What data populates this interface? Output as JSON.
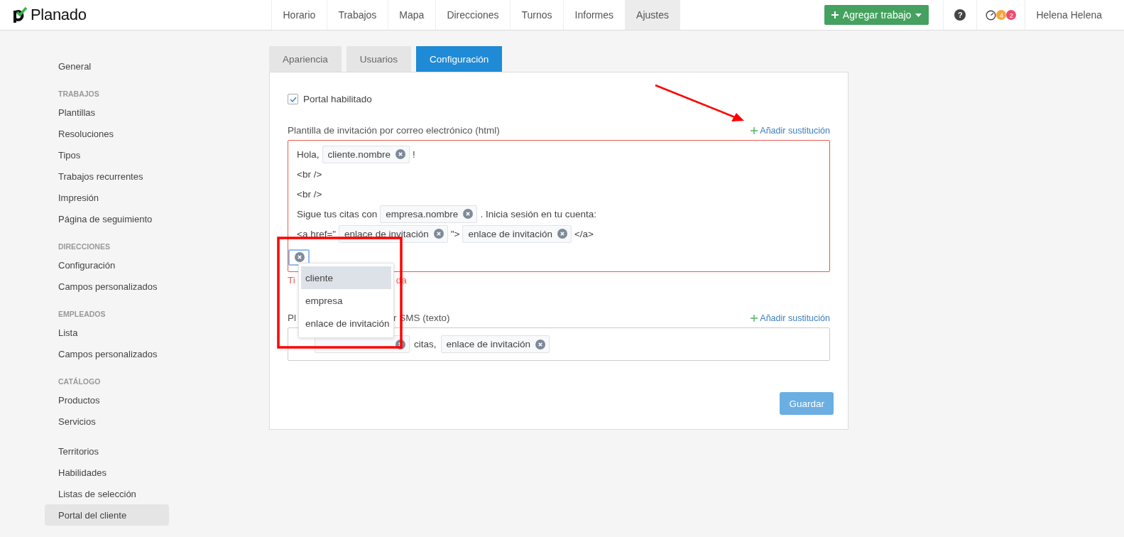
{
  "brand": {
    "name": "Planado"
  },
  "nav": [
    {
      "label": "Horario",
      "selected": false
    },
    {
      "label": "Trabajos",
      "selected": false
    },
    {
      "label": "Mapa",
      "selected": false
    },
    {
      "label": "Direcciones",
      "selected": false
    },
    {
      "label": "Turnos",
      "selected": false
    },
    {
      "label": "Informes",
      "selected": false
    },
    {
      "label": "Ajustes",
      "selected": true
    }
  ],
  "add_job_button": "Agregar trabajo",
  "help_icon": "?",
  "badges": [
    {
      "count": "4",
      "color": "#f5a73c"
    },
    {
      "count": "2",
      "color": "#ef4c6d"
    }
  ],
  "user": "Helena Helena",
  "sidebar": [
    {
      "kind": "item",
      "label": "General",
      "selected": false
    },
    {
      "kind": "heading",
      "label": "TRABAJOS"
    },
    {
      "kind": "item",
      "label": "Plantillas",
      "selected": false
    },
    {
      "kind": "item",
      "label": "Resoluciones",
      "selected": false
    },
    {
      "kind": "item",
      "label": "Tipos",
      "selected": false
    },
    {
      "kind": "item",
      "label": "Trabajos recurrentes",
      "selected": false
    },
    {
      "kind": "item",
      "label": "Impresión",
      "selected": false
    },
    {
      "kind": "item",
      "label": "Página de seguimiento",
      "selected": false
    },
    {
      "kind": "heading",
      "label": "DIRECCIONES"
    },
    {
      "kind": "item",
      "label": "Configuración",
      "selected": false
    },
    {
      "kind": "item",
      "label": "Campos personalizados",
      "selected": false
    },
    {
      "kind": "heading",
      "label": "EMPLEADOS"
    },
    {
      "kind": "item",
      "label": "Lista",
      "selected": false
    },
    {
      "kind": "item",
      "label": "Campos personalizados",
      "selected": false
    },
    {
      "kind": "heading",
      "label": "CATÁLOGO"
    },
    {
      "kind": "item",
      "label": "Productos",
      "selected": false
    },
    {
      "kind": "item",
      "label": "Servicios",
      "selected": false
    },
    {
      "kind": "spacer"
    },
    {
      "kind": "item",
      "label": "Territorios",
      "selected": false
    },
    {
      "kind": "item",
      "label": "Habilidades",
      "selected": false
    },
    {
      "kind": "item",
      "label": "Listas de selección",
      "selected": false
    },
    {
      "kind": "item",
      "label": "Portal del cliente",
      "selected": true
    }
  ],
  "tabs": [
    {
      "label": "Apariencia",
      "selected": false
    },
    {
      "label": "Usuarios",
      "selected": false
    },
    {
      "label": "Configuración",
      "selected": true
    }
  ],
  "portal_enabled": {
    "label": "Portal habilitado",
    "checked": true
  },
  "email_template": {
    "label": "Plantilla de invitación por correo electrónico (html)",
    "add_link": "Añadir sustitución",
    "invalid": true,
    "lines": [
      [
        {
          "kind": "text",
          "text": "Hola,"
        },
        {
          "kind": "chip",
          "text": "cliente.nombre"
        },
        {
          "kind": "text",
          "text": "!"
        }
      ],
      [
        {
          "kind": "text",
          "text": "<br />"
        }
      ],
      [
        {
          "kind": "text",
          "text": "<br />"
        }
      ],
      [
        {
          "kind": "text",
          "text": "Sigue tus citas con"
        },
        {
          "kind": "chip",
          "text": "empresa.nombre"
        },
        {
          "kind": "text",
          "text": ". Inicia sesión en tu cuenta:"
        }
      ],
      [
        {
          "kind": "text",
          "text": "<a href=\""
        },
        {
          "kind": "chip",
          "text": "enlace de invitación"
        },
        {
          "kind": "text",
          "text": "\">"
        },
        {
          "kind": "chip",
          "text": "enlace de invitación"
        },
        {
          "kind": "text",
          "text": "</a>"
        }
      ],
      [
        {
          "kind": "input"
        }
      ]
    ],
    "error_parts": [
      "Ti",
      "da"
    ]
  },
  "dropdown": [
    {
      "label": "cliente",
      "selected": true
    },
    {
      "label": "empresa",
      "selected": false
    },
    {
      "label": "enlace de invitación",
      "selected": false
    }
  ],
  "sms_template": {
    "label_parts": [
      "Pl",
      "r SMS (texto)"
    ],
    "add_link": "Añadir sustitución",
    "items": [
      {
        "kind": "covered_chip"
      },
      {
        "kind": "text",
        "text": "citas,"
      },
      {
        "kind": "chip",
        "text": "enlace de invitación"
      }
    ]
  },
  "save_button": "Guardar"
}
